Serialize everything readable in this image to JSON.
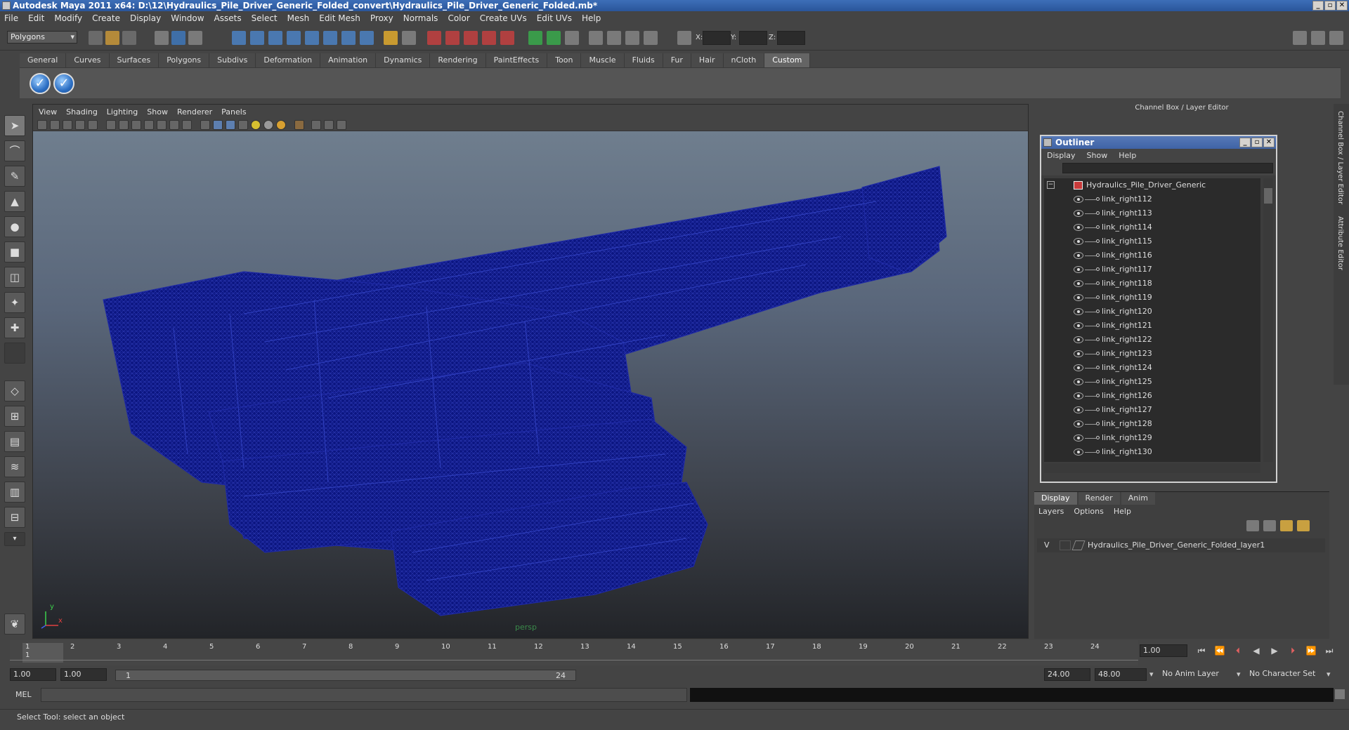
{
  "title": "Autodesk Maya 2011 x64: D:\\12\\Hydraulics_Pile_Driver_Generic_Folded_convert\\Hydraulics_Pile_Driver_Generic_Folded.mb*",
  "window_buttons": [
    "_",
    "▫",
    "✕"
  ],
  "menubar": [
    "File",
    "Edit",
    "Modify",
    "Create",
    "Display",
    "Window",
    "Assets",
    "Select",
    "Mesh",
    "Edit Mesh",
    "Proxy",
    "Normals",
    "Color",
    "Create UVs",
    "Edit UVs",
    "Help"
  ],
  "mode_selector": "Polygons",
  "coords": {
    "x": "X:",
    "y": "Y:",
    "z": "Z:"
  },
  "shelf_tabs": [
    "General",
    "Curves",
    "Surfaces",
    "Polygons",
    "Subdivs",
    "Deformation",
    "Animation",
    "Dynamics",
    "Rendering",
    "PaintEffects",
    "Toon",
    "Muscle",
    "Fluids",
    "Fur",
    "Hair",
    "nCloth",
    "Custom"
  ],
  "shelf_active": "Custom",
  "viewport": {
    "menu": [
      "View",
      "Shading",
      "Lighting",
      "Show",
      "Renderer",
      "Panels"
    ],
    "camera": "persp",
    "axis_x": "x",
    "axis_y": "y"
  },
  "channel_box_title": "Channel Box / Layer Editor",
  "side_tabs": [
    "Channel Box / Layer Editor",
    "Attribute Editor"
  ],
  "outliner": {
    "title": "Outliner",
    "menu": [
      "Display",
      "Show",
      "Help"
    ],
    "root": "Hydraulics_Pile_Driver_Generic",
    "collapse": "−",
    "items": [
      "link_right112",
      "link_right113",
      "link_right114",
      "link_right115",
      "link_right116",
      "link_right117",
      "link_right118",
      "link_right119",
      "link_right120",
      "link_right121",
      "link_right122",
      "link_right123",
      "link_right124",
      "link_right125",
      "link_right126",
      "link_right127",
      "link_right128",
      "link_right129",
      "link_right130"
    ]
  },
  "layers": {
    "tabs": [
      "Display",
      "Render",
      "Anim"
    ],
    "menu": [
      "Layers",
      "Options",
      "Help"
    ],
    "visibility": "V",
    "layer_name": "Hydraulics_Pile_Driver_Generic_Folded_layer1"
  },
  "timeline": {
    "ticks": [
      "1",
      "2",
      "3",
      "4",
      "5",
      "6",
      "7",
      "8",
      "9",
      "10",
      "11",
      "12",
      "13",
      "14",
      "15",
      "16",
      "17",
      "18",
      "19",
      "20",
      "21",
      "22",
      "23",
      "24"
    ],
    "current_frame": "1.00",
    "cursor_label": "1"
  },
  "range": {
    "start": "1.00",
    "playback_start": "1.00",
    "slider_start": "1",
    "slider_end": "24",
    "playback_end": "24.00",
    "end": "48.00",
    "anim_layer": "No Anim Layer",
    "character_set": "No Character Set"
  },
  "cmd": {
    "label": "MEL"
  },
  "help_line": "Select Tool: select an object",
  "colors": {
    "wireframe": "#0b1580",
    "title_bar": "#2f5ea8"
  }
}
